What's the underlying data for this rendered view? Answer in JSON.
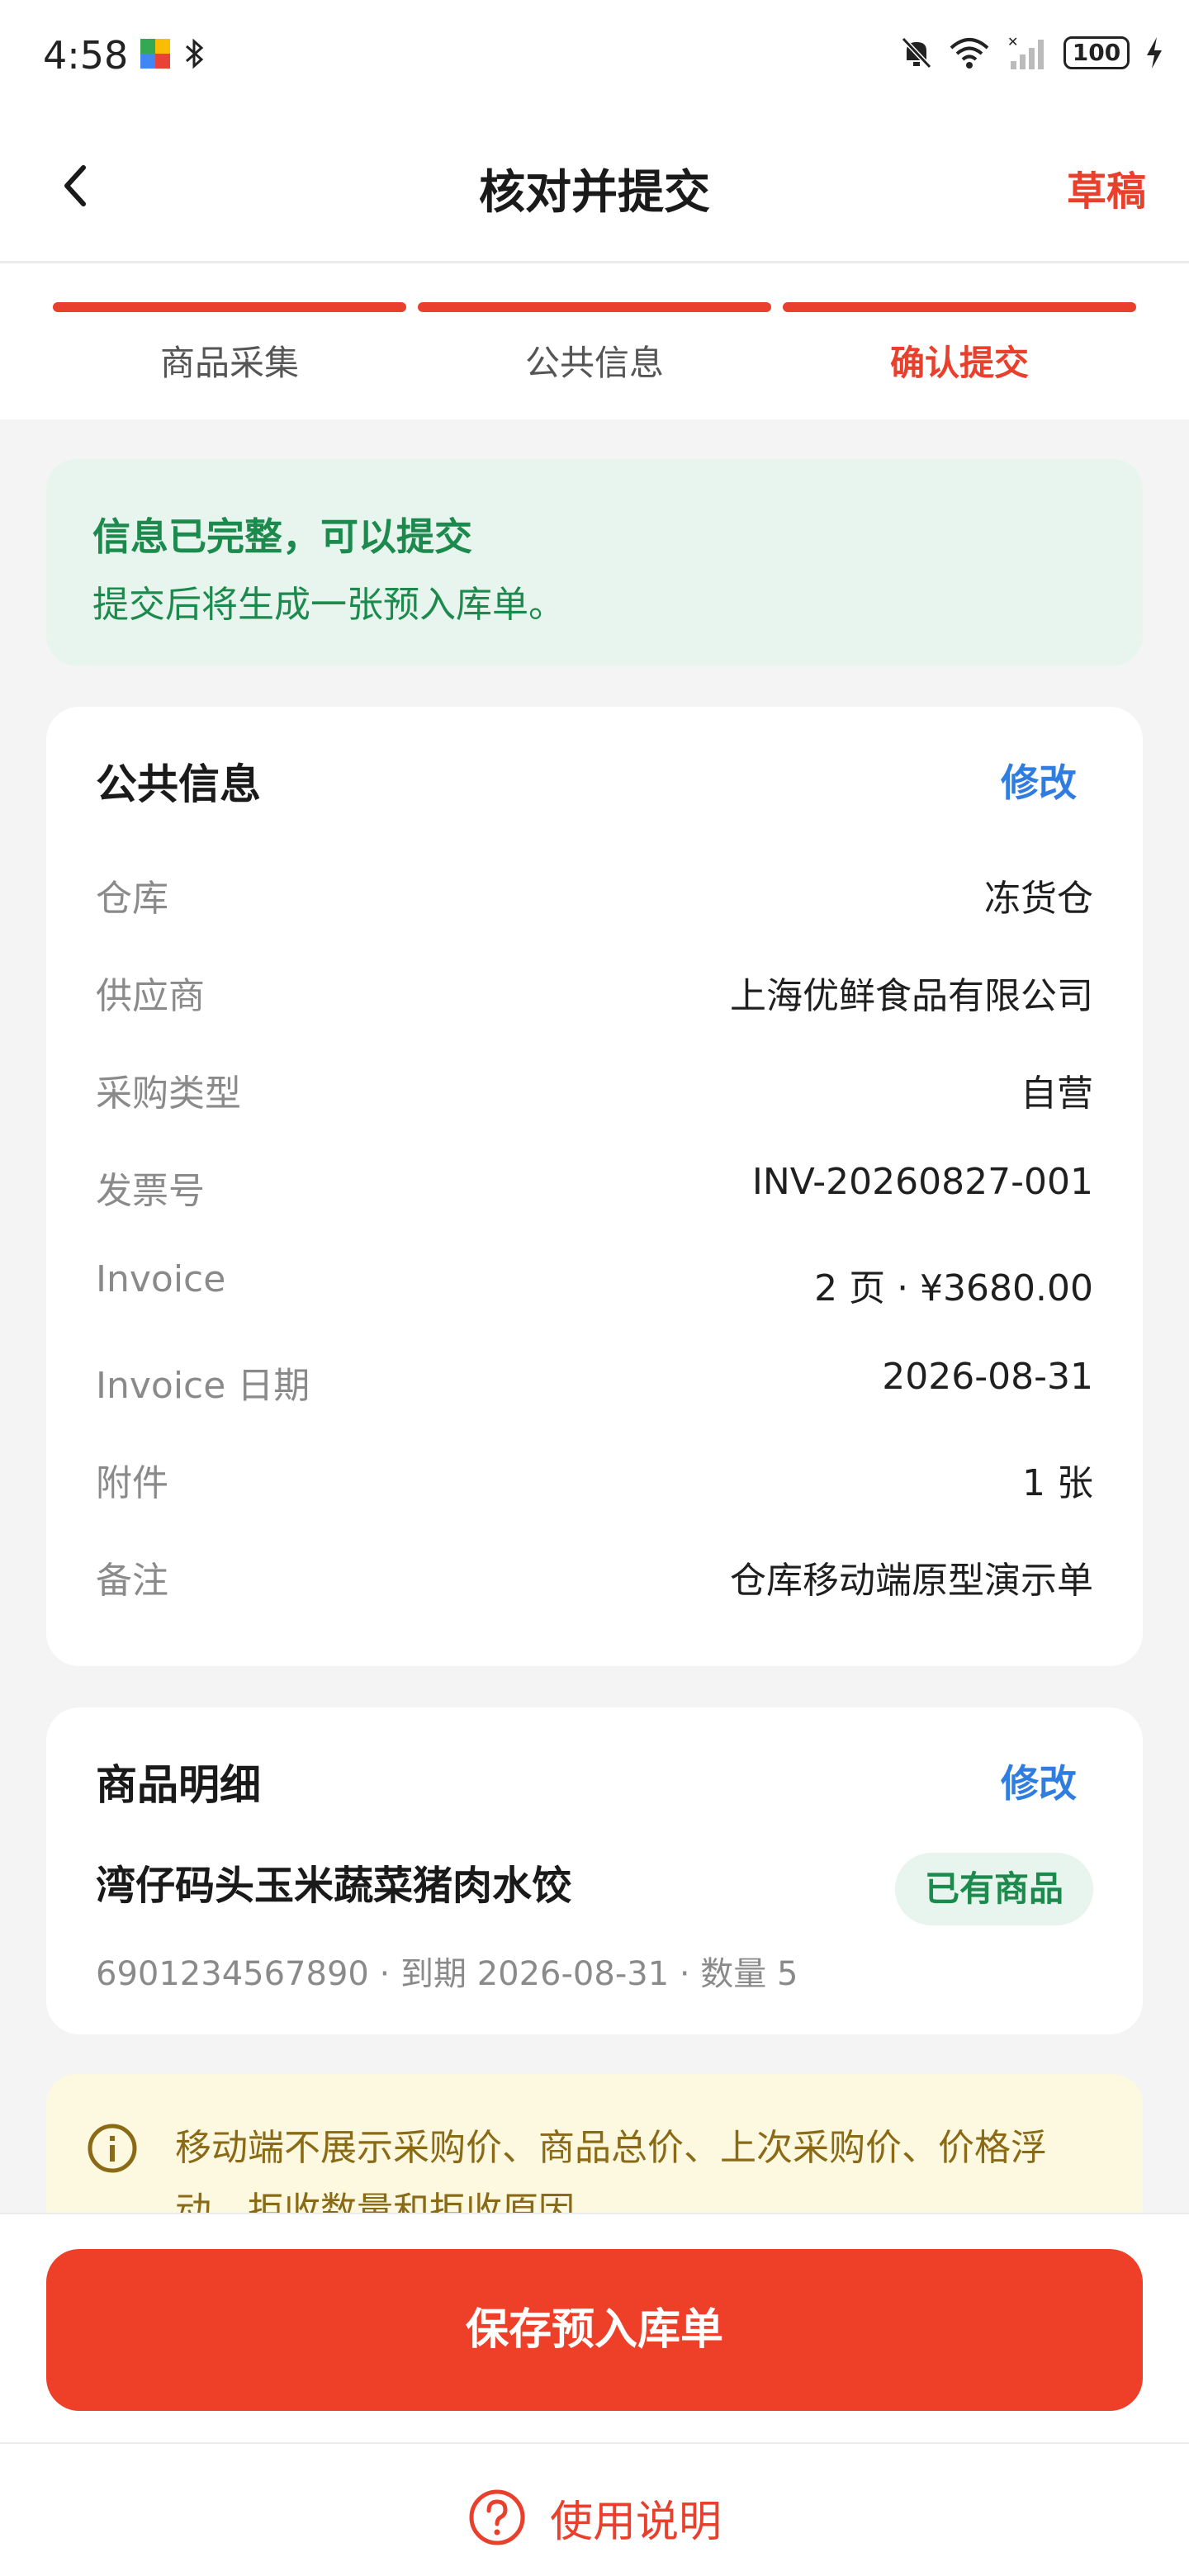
{
  "status_bar": {
    "time": "4:58",
    "battery": "100",
    "icons": [
      "app-icon",
      "bluetooth-icon",
      "mute-icon",
      "wifi-icon",
      "signal-icon",
      "battery-icon",
      "charging-icon"
    ]
  },
  "header": {
    "title": "核对并提交",
    "draft": "草稿",
    "back_icon": "chevron-left-icon"
  },
  "steps": [
    {
      "label": "商品采集",
      "active": false
    },
    {
      "label": "公共信息",
      "active": false
    },
    {
      "label": "确认提交",
      "active": true
    }
  ],
  "banner": {
    "title": "信息已完整，可以提交",
    "desc": "提交后将生成一张预入库单。"
  },
  "public_info": {
    "title": "公共信息",
    "edit": "修改",
    "rows": [
      {
        "key": "仓库",
        "value": "冻货仓"
      },
      {
        "key": "供应商",
        "value": "上海优鲜食品有限公司"
      },
      {
        "key": "采购类型",
        "value": "自营"
      },
      {
        "key": "发票号",
        "value": "INV-20260827-001"
      },
      {
        "key": "Invoice",
        "value": "2 页 · ¥3680.00"
      },
      {
        "key": "Invoice 日期",
        "value": "2026-08-31"
      },
      {
        "key": "附件",
        "value": "1 张"
      },
      {
        "key": "备注",
        "value": "仓库移动端原型演示单"
      }
    ]
  },
  "goods": {
    "title": "商品明细",
    "edit": "修改",
    "name": "湾仔码头玉米蔬菜猪肉水饺",
    "tag": "已有商品",
    "meta": "6901234567890 · 到期 2026-08-31 · 数量 5"
  },
  "notice": {
    "text": "移动端不展示采购价、商品总价、上次采购价、价格浮动、拒收数量和拒收原因",
    "icon": "info-icon"
  },
  "actions": {
    "save": "保存预入库单",
    "help": "使用说明",
    "help_icon": "question-circle-icon"
  },
  "colors": {
    "accent": "#e8402c",
    "success": "#1d8a4d",
    "link": "#2f7de1",
    "notice_bg": "#fdf9e0"
  }
}
